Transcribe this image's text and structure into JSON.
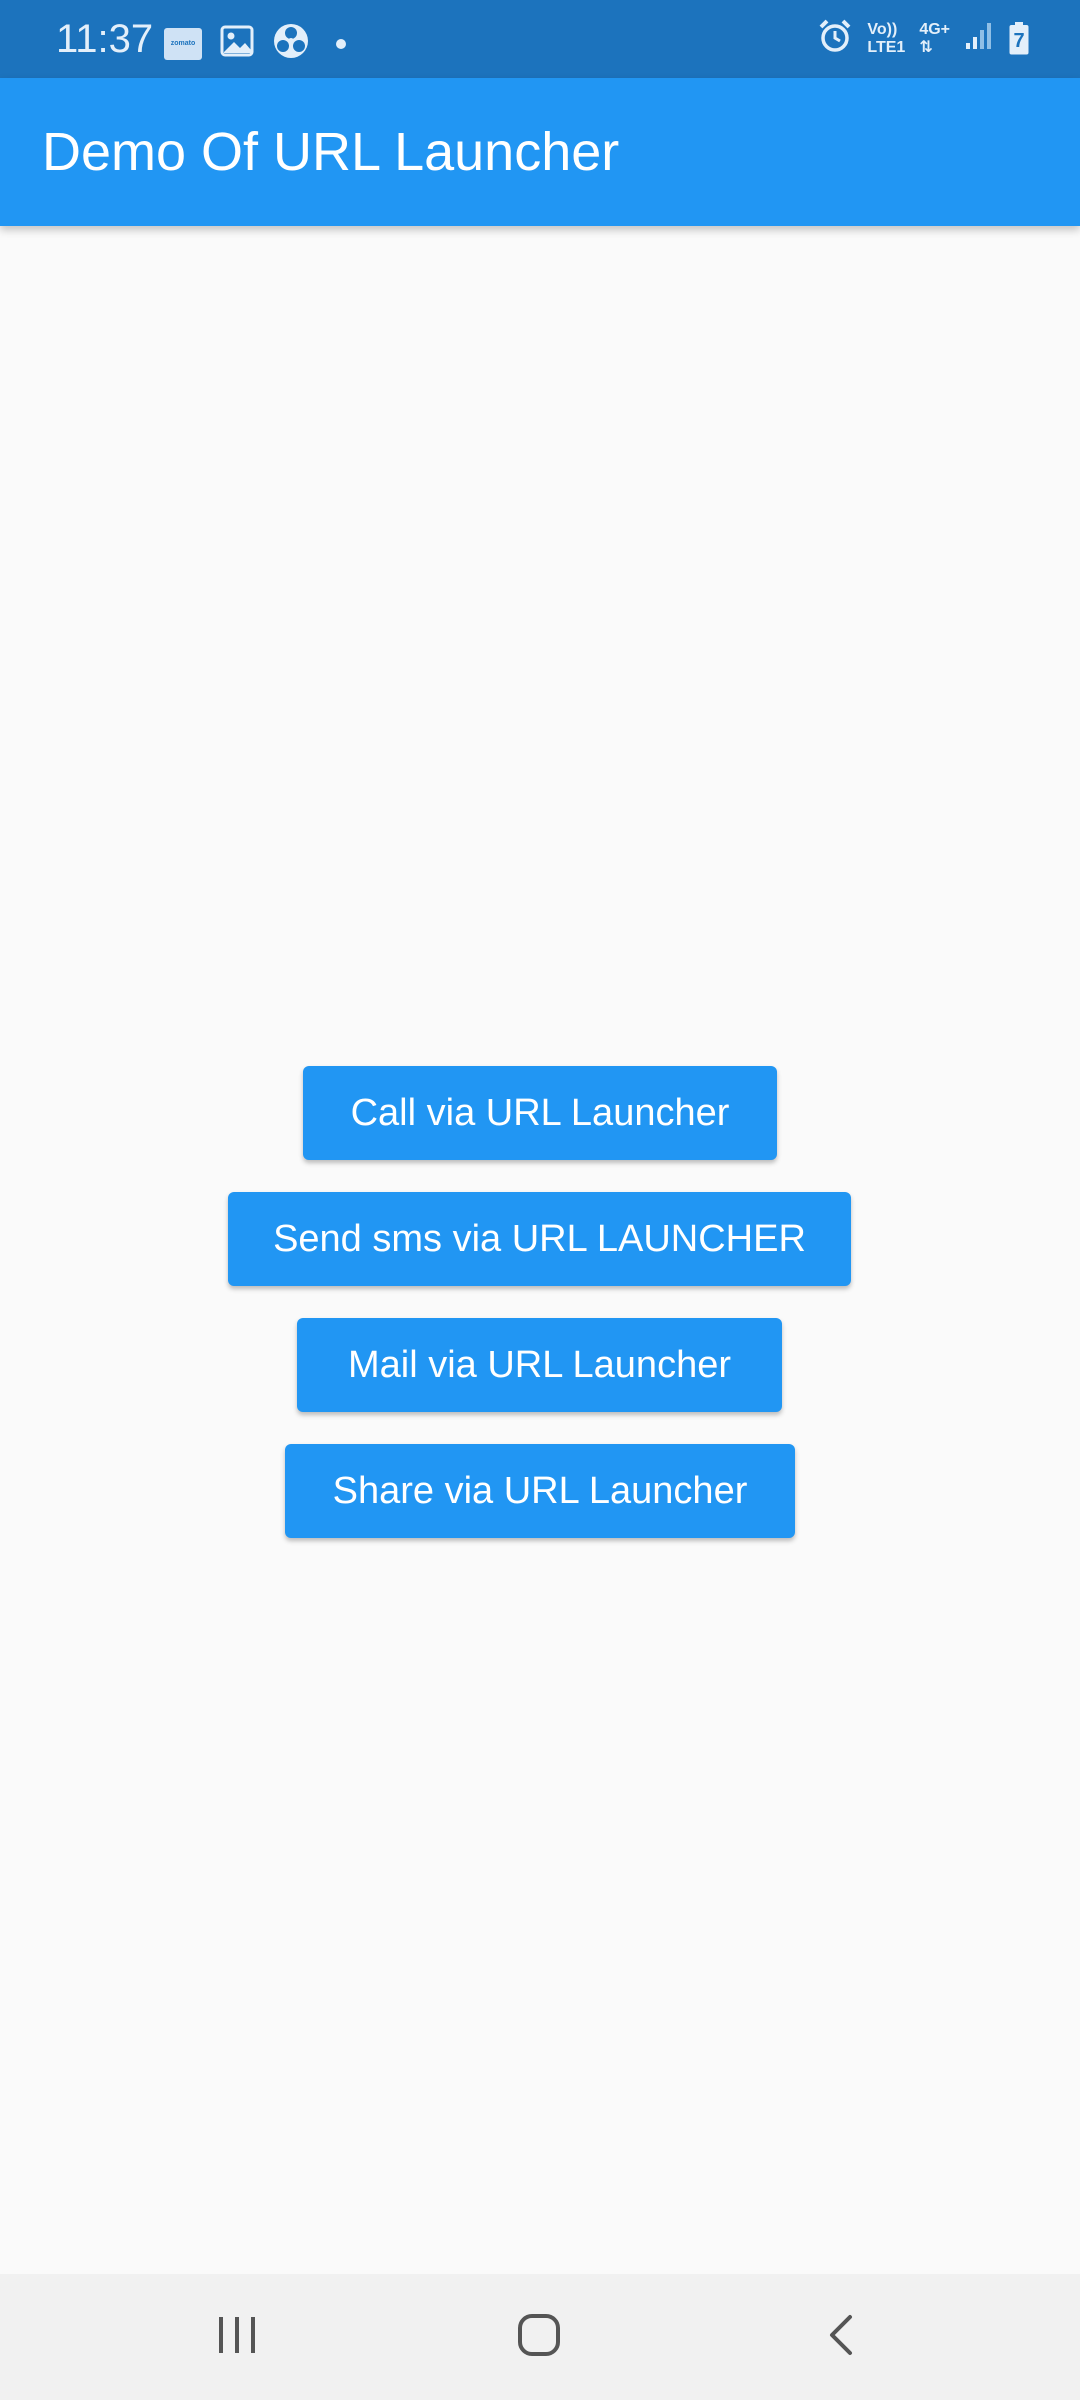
{
  "status_bar": {
    "time": "11:37",
    "zomato_label": "zomato",
    "network_line1": "Vo))",
    "network_line2": "LTE1",
    "network_type": "4G+",
    "battery_level": "7",
    "icons": [
      "zomato-app-icon",
      "gallery-icon",
      "fan-icon",
      "dot-icon",
      "alarm-icon",
      "signal-icon",
      "battery-icon"
    ]
  },
  "app_bar": {
    "title": "Demo Of URL Launcher"
  },
  "buttons": {
    "call": "Call via URL Launcher",
    "sms": "Send sms via URL LAUNCHER",
    "mail": "Mail via URL Launcher",
    "share": "Share via URL Launcher"
  },
  "nav_bar": {
    "icons": [
      "recents-icon",
      "home-icon",
      "back-icon"
    ]
  },
  "colors": {
    "status_bar": "#1c73bd",
    "app_bar": "#2196f3",
    "button": "#2196f3",
    "background": "#fafafa",
    "nav_bar": "#f1f1f1"
  }
}
